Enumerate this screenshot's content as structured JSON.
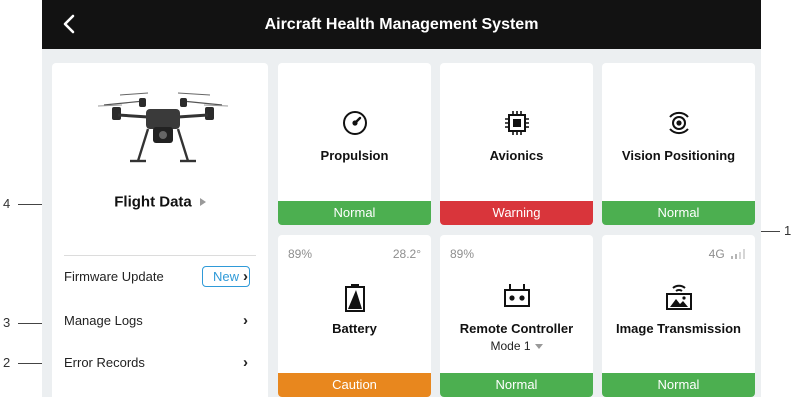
{
  "header": {
    "title": "Aircraft Health Management System"
  },
  "left_panel": {
    "flight_data_label": "Flight Data",
    "menu": [
      {
        "label": "Firmware Update",
        "badge": "New"
      },
      {
        "label": "Manage Logs"
      },
      {
        "label": "Error Records"
      }
    ]
  },
  "tiles": {
    "propulsion": {
      "label": "Propulsion",
      "status": "Normal"
    },
    "avionics": {
      "label": "Avionics",
      "status": "Warning"
    },
    "vision": {
      "label": "Vision Positioning",
      "status": "Normal"
    },
    "battery": {
      "label": "Battery",
      "status": "Caution",
      "percent": "89%",
      "temperature": "28.2°"
    },
    "remote": {
      "label": "Remote Controller",
      "status": "Normal",
      "percent": "89%",
      "mode": "Mode 1"
    },
    "transmission": {
      "label": "Image Transmission",
      "status": "Normal",
      "network": "4G"
    }
  },
  "callouts": [
    "1",
    "2",
    "3",
    "4"
  ],
  "colors": {
    "normal": "#4caf50",
    "warning": "#d9353b",
    "caution": "#e8871e",
    "badge": "#2f9ad8",
    "header": "#121212"
  },
  "icons": {
    "back": "chevron-left-icon",
    "propulsion": "propeller-gauge-icon",
    "avionics": "chip-icon",
    "vision": "vision-sensor-icon",
    "battery": "battery-icon",
    "remote": "remote-controller-icon",
    "transmission": "image-transmission-icon",
    "signal": "signal-bars-icon"
  }
}
